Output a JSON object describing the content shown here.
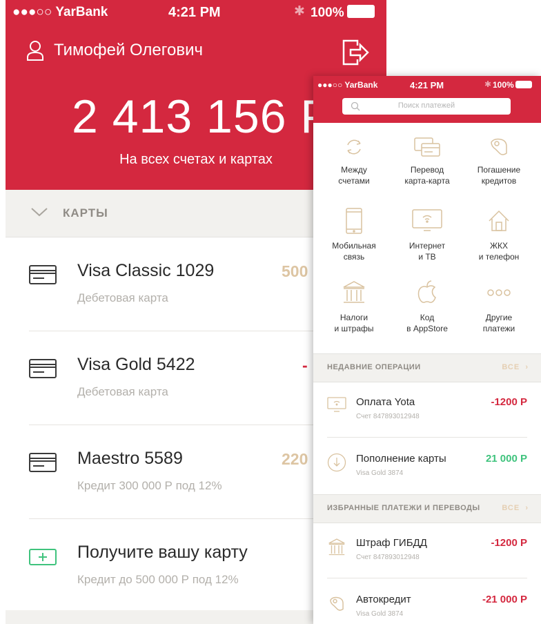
{
  "colors": {
    "brand": "#d4283f",
    "accent_gold": "#ddc5a3",
    "positive": "#3fc37d"
  },
  "left_screen": {
    "status": {
      "carrier": "●●●○○ YarBank",
      "time": "4:21 PM",
      "battery": "100%"
    },
    "user_name": "Тимофей Олегович",
    "total_amount": "2 413 156 Р",
    "total_label": "На всех счетах и картах",
    "cards_section": "КАРТЫ",
    "cards": [
      {
        "name": "Visa Classic 1029",
        "subtitle": "Дебетовая карта",
        "amount": "500",
        "icon": "card-icon"
      },
      {
        "name": "Visa Gold 5422",
        "subtitle": "Дебетовая карта",
        "amount": "-",
        "icon": "card-icon"
      },
      {
        "name": "Maestro 5589",
        "subtitle": "Кредит 300 000 Р под 12%",
        "amount": "220",
        "icon": "card-icon"
      },
      {
        "name": "Получите вашу карту",
        "subtitle": "Кредит до 500 000 Р под 12%",
        "amount": "",
        "icon": "add-card-icon"
      }
    ]
  },
  "right_screen": {
    "status": {
      "carrier": "●●●○○ YarBank",
      "time": "4:21 PM",
      "battery": "100%"
    },
    "search_placeholder": "Поиск платежей",
    "grid": [
      {
        "label1": "Между",
        "label2": "счетами",
        "icon": "transfer-arrows-icon"
      },
      {
        "label1": "Перевод",
        "label2": "карта-карта",
        "icon": "cards-icon"
      },
      {
        "label1": "Погашение",
        "label2": "кредитов",
        "icon": "car-icon"
      },
      {
        "label1": "Мобильная",
        "label2": "связь",
        "icon": "phone-icon"
      },
      {
        "label1": "Интернет",
        "label2": "и ТВ",
        "icon": "tv-wifi-icon"
      },
      {
        "label1": "ЖКХ",
        "label2": "и телефон",
        "icon": "house-icon"
      },
      {
        "label1": "Налоги",
        "label2": "и штрафы",
        "icon": "bank-icon"
      },
      {
        "label1": "Код",
        "label2": "в AppStore",
        "icon": "apple-icon"
      },
      {
        "label1": "Другие",
        "label2": "платежи",
        "icon": "more-icon"
      }
    ],
    "recent_header": "НЕДАВНИЕ ОПЕРАЦИИ",
    "recent_all": "ВСЕ",
    "recent": [
      {
        "title": "Оплата Yota",
        "subtitle": "Счет 847893012948",
        "amount": "-1200 Р",
        "icon": "tv-wifi-icon",
        "positive": false
      },
      {
        "title": "Пополнение карты",
        "subtitle": "Visa Gold 3874",
        "amount": "21 000 Р",
        "icon": "download-circle-icon",
        "positive": true
      }
    ],
    "favorites_header": "ИЗБРАННЫЕ ПЛАТЕЖИ И ПЕРЕВОДЫ",
    "favorites_all": "ВСЕ",
    "favorites": [
      {
        "title": "Штраф ГИБДД",
        "subtitle": "Счет 847893012948",
        "amount": "-1200 Р",
        "icon": "bank-icon"
      },
      {
        "title": "Автокредит",
        "subtitle": "Visa Gold 3874",
        "amount": "-21 000 Р",
        "icon": "car-icon"
      }
    ]
  }
}
